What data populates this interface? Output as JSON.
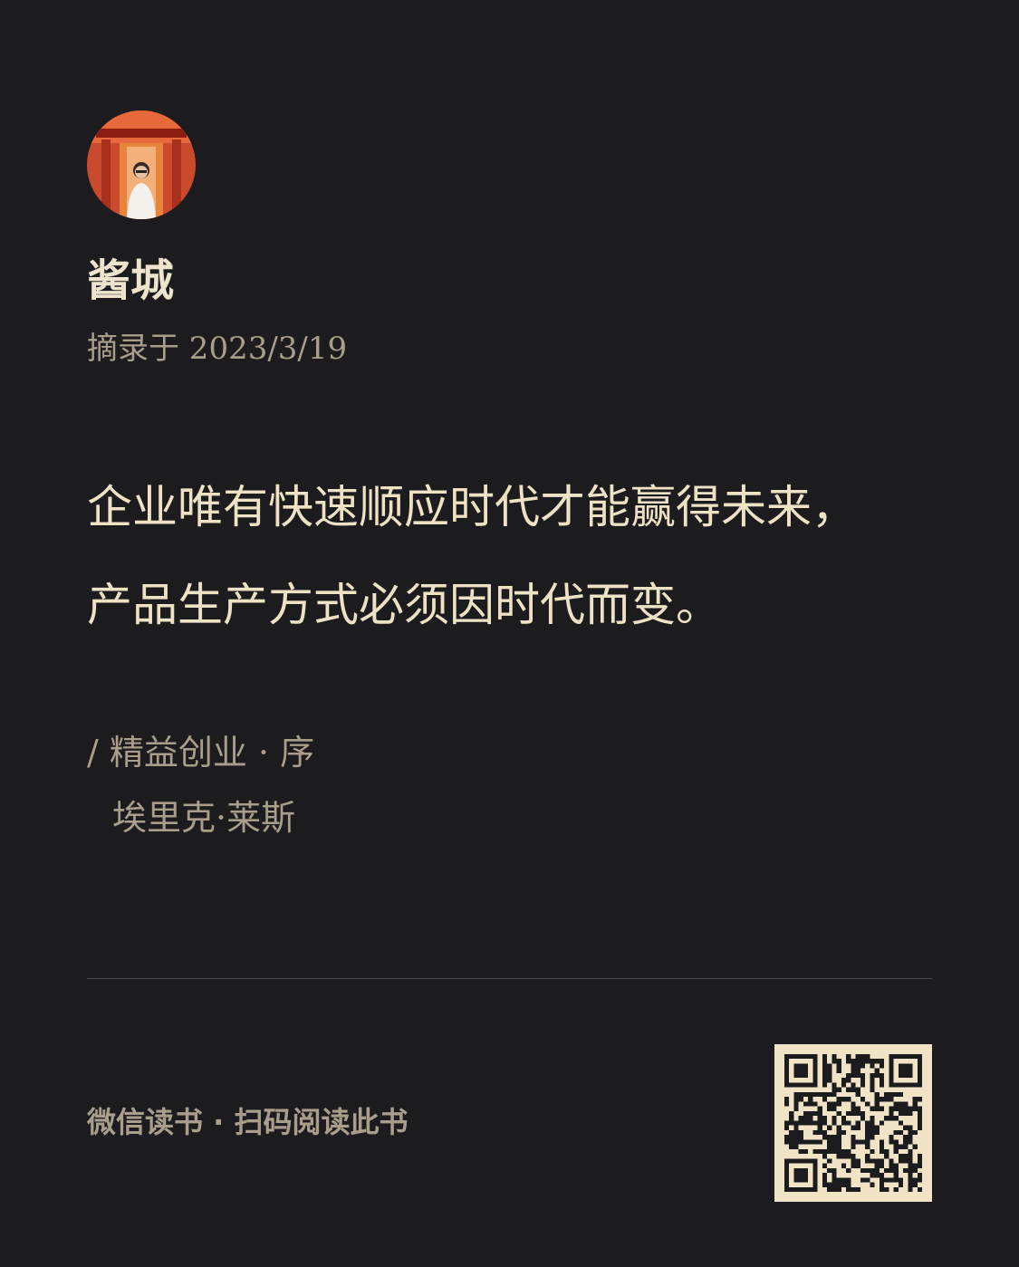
{
  "user": {
    "name": "酱城",
    "avatar": "avatar-photo"
  },
  "excerpt": {
    "date_label": "摘录于 2023/3/19"
  },
  "quote": {
    "lines": [
      "企业唯有快速顺应时代才能赢得未来，",
      "产品生产方式必须因时代而变。"
    ]
  },
  "source": {
    "book_line": "/ 精益创业 · 序",
    "author": "埃里克·莱斯"
  },
  "footer": {
    "text": "微信读书 · 扫码阅读此书",
    "qr": "qr-code"
  },
  "colors": {
    "background": "#1c1c1f",
    "quote_text": "#ede2c4",
    "muted_text": "#a89e8b",
    "qr_background": "#f1e4c6"
  }
}
